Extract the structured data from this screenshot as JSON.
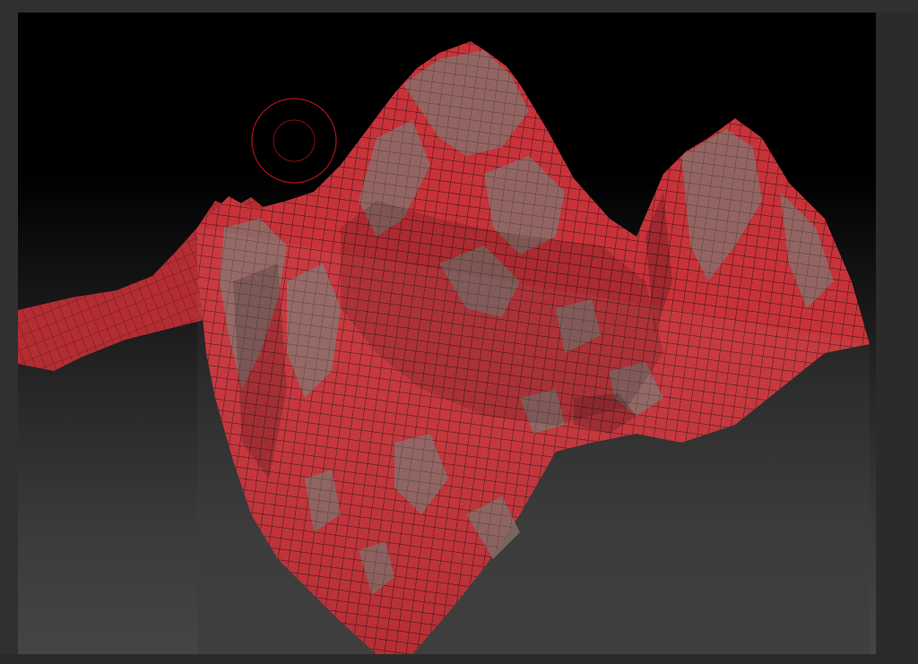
{
  "app": {
    "view": "3d-sculpt-viewport"
  },
  "viewport": {
    "background_top": "#000000",
    "background_bottom": "#454545",
    "mesh": {
      "name": "terrain-mesh",
      "material_color": "#c8333a",
      "exposed_rock_color": "#8a6e6a",
      "wire_color": "#2a1010",
      "wireframe": true
    },
    "brush_cursor": {
      "icon": "brush-cursor-icon",
      "color": "#b0121a"
    }
  }
}
